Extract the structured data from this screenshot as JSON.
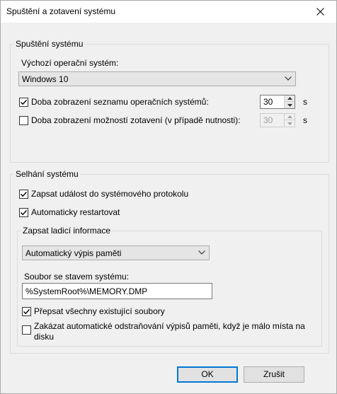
{
  "window": {
    "title": "Spuštění a zotavení systému"
  },
  "startup": {
    "legend": "Spuštění systému",
    "default_os_label": "Výchozí operační systém:",
    "default_os_value": "Windows 10",
    "show_list": {
      "label": "Doba zobrazení seznamu operačních systémů:",
      "checked": true,
      "value": "30",
      "unit": "s"
    },
    "show_recovery": {
      "label": "Doba zobrazení možností zotavení (v případě nutnosti):",
      "checked": false,
      "value": "30",
      "unit": "s"
    }
  },
  "failure": {
    "legend": "Selhání systému",
    "write_event": {
      "label": "Zapsat událost do systémového protokolu",
      "checked": true
    },
    "auto_restart": {
      "label": "Automaticky restartovat",
      "checked": true
    },
    "debug": {
      "legend": "Zapsat ladicí informace",
      "dump_type": "Automatický výpis paměti",
      "dump_file_label": "Soubor se stavem systému:",
      "dump_file_value": "%SystemRoot%\\MEMORY.DMP",
      "overwrite": {
        "label": "Přepsat všechny existující soubory",
        "checked": true
      },
      "disable_auto_delete": {
        "label_line1": "Zakázat automatické odstraňování výpisů paměti, když je málo místa na",
        "label_line2": "disku",
        "checked": false
      }
    }
  },
  "buttons": {
    "ok": "OK",
    "cancel": "Zrušit"
  },
  "icons": {
    "close": "close-icon",
    "check": "check-icon",
    "dropdown": "chevron-down-icon",
    "spin_up": "spin-up-icon",
    "spin_down": "spin-down-icon"
  }
}
